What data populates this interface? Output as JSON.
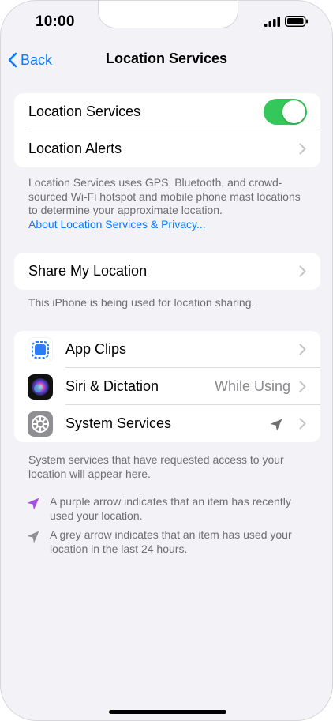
{
  "status_bar": {
    "time": "10:00"
  },
  "nav": {
    "back_label": "Back",
    "title": "Location Services"
  },
  "group1": {
    "location_services_label": "Location Services",
    "location_services_on": true,
    "location_alerts_label": "Location Alerts"
  },
  "footer1": {
    "text": "Location Services uses GPS, Bluetooth, and crowd-sourced Wi-Fi hotspot and mobile phone mast locations to determine your approximate location.",
    "link": "About Location Services & Privacy..."
  },
  "group2": {
    "share_label": "Share My Location"
  },
  "footer2": {
    "text": "This iPhone is being used for location sharing."
  },
  "apps": [
    {
      "label": "App Clips",
      "icon": "app-clips-icon"
    },
    {
      "label": "Siri & Dictation",
      "value": "While Using",
      "icon": "siri-icon"
    },
    {
      "label": "System Services",
      "icon": "settings-gear-icon",
      "arrow_color": "#8e8e93"
    }
  ],
  "footer3": {
    "text": "System services that have requested access to your location will appear here."
  },
  "legend": {
    "purple_text": "A purple arrow indicates that an item has recently used your location.",
    "purple_color": "#a550e0",
    "grey_text": "A grey arrow indicates that an item has used your location in the last 24 hours.",
    "grey_color": "#8e8e93"
  },
  "colors": {
    "accent": "#0a7aff",
    "toggle_on": "#34c759",
    "background": "#f2f2f7"
  }
}
